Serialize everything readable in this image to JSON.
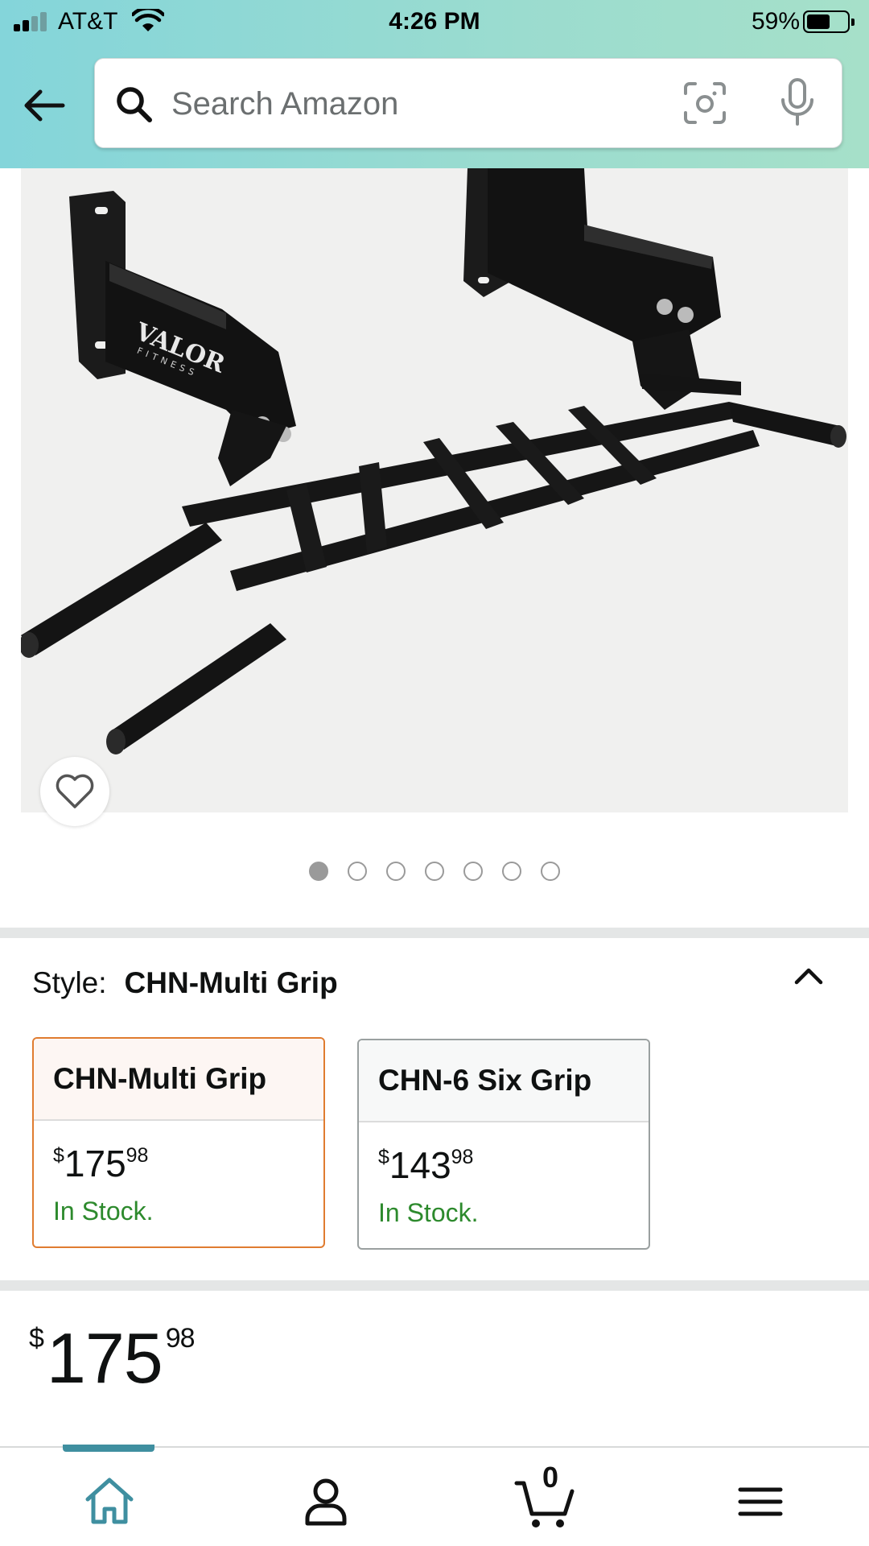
{
  "status_bar": {
    "carrier": "AT&T",
    "time": "4:26 PM",
    "battery_percent": "59%",
    "battery_level": 0.59,
    "signal_bars": 2
  },
  "header": {
    "back_icon": "arrow-left-icon",
    "search": {
      "placeholder": "Search Amazon",
      "value": "",
      "icons": [
        "search-icon",
        "camera-scan-icon",
        "microphone-icon"
      ]
    },
    "colors": {
      "gradient_start": "#84d5da",
      "gradient_end": "#a6e0c9"
    }
  },
  "product_image": {
    "brand_mark": "VALOR FITNESS",
    "favorite_icon": "heart-outline-icon",
    "carousel": {
      "total": 7,
      "active_index": 0
    }
  },
  "style_selector": {
    "label": "Style:",
    "selected_value": "CHN-Multi Grip",
    "collapse_icon": "chevron-up-icon",
    "options": [
      {
        "name": "CHN-Multi Grip",
        "currency": "$",
        "price_whole": "175",
        "price_fraction": "98",
        "stock": "In Stock.",
        "selected": true
      },
      {
        "name": "CHN-6 Six Grip",
        "currency": "$",
        "price_whole": "143",
        "price_fraction": "98",
        "stock": "In Stock.",
        "selected": false
      }
    ],
    "colors": {
      "selected_border": "#e07c30",
      "stock_green": "#2d8a2d"
    }
  },
  "price": {
    "currency": "$",
    "whole": "175",
    "fraction": "98"
  },
  "bottom_nav": {
    "items": [
      "home-icon",
      "account-icon",
      "cart-icon",
      "menu-icon"
    ],
    "active": "home-icon",
    "cart_count": "0",
    "colors": {
      "active": "#3f8fa0"
    }
  }
}
